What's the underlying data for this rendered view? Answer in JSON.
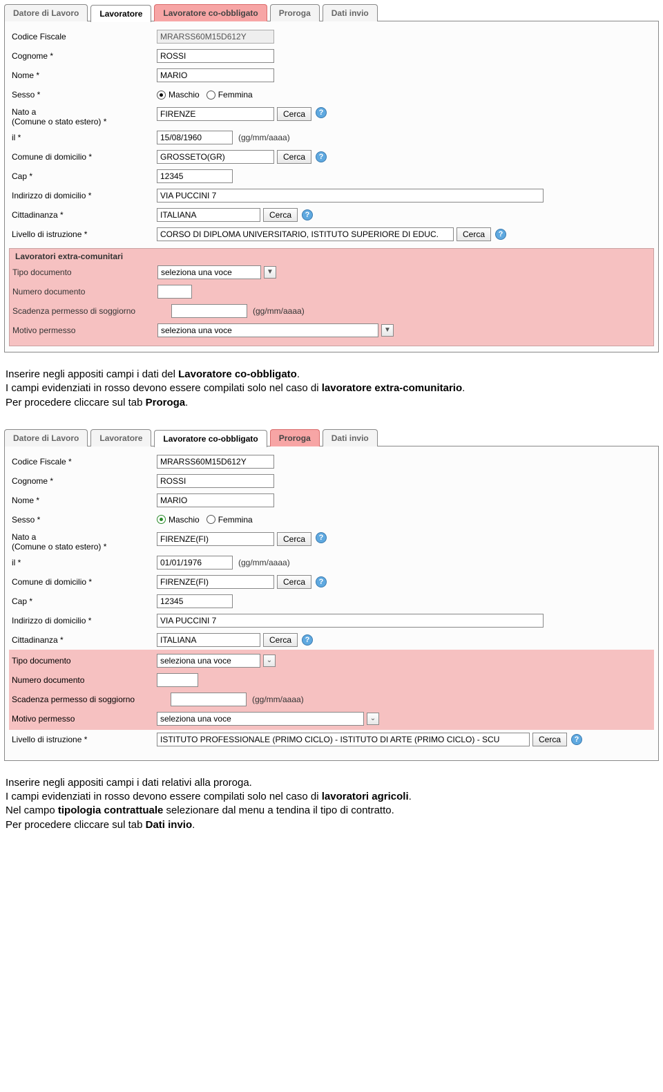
{
  "common": {
    "cerca": "Cerca",
    "date_hint": "(gg/mm/aaaa)",
    "maschio": "Maschio",
    "femmina": "Femmina",
    "dropdown_placeholder": "seleziona una voce"
  },
  "tabs": {
    "t1": "Datore di Lavoro",
    "t2": "Lavoratore",
    "t3": "Lavoratore co-obbligato",
    "t4": "Proroga",
    "t5": "Dati invio"
  },
  "form1": {
    "labels": {
      "codice_fiscale": "Codice Fiscale",
      "cognome": "Cognome *",
      "nome": "Nome *",
      "sesso": "Sesso *",
      "nato_a": "Nato a\n(Comune o stato estero) *",
      "il": "il *",
      "comune_dom": "Comune di domicilio *",
      "cap": "Cap *",
      "indirizzo": "Indirizzo di domicilio *",
      "cittadinanza": "Cittadinanza *",
      "livello_istr": "Livello di istruzione *",
      "extra_title": "Lavoratori extra-comunitari",
      "tipo_doc": "Tipo documento",
      "num_doc": "Numero documento",
      "scadenza": "Scadenza permesso di soggiorno",
      "motivo": "Motivo permesso"
    },
    "values": {
      "codice_fiscale": "MRARSS60M15D612Y",
      "cognome": "ROSSI",
      "nome": "MARIO",
      "nato_a": "FIRENZE",
      "il": "15/08/1960",
      "comune_dom": "GROSSETO(GR)",
      "cap": "12345",
      "indirizzo": "VIA PUCCINI 7",
      "cittadinanza": "ITALIANA",
      "livello_istr": "CORSO DI DIPLOMA UNIVERSITARIO, ISTITUTO SUPERIORE DI EDUC."
    }
  },
  "instr1": {
    "line1a": "Inserire negli appositi campi i dati del ",
    "line1b": "Lavoratore co-obbligato",
    "line1c": ".",
    "line2a": "I campi evidenziati in rosso devono essere compilati solo nel caso di ",
    "line2b": "lavoratore extra-comunitario",
    "line2c": ".",
    "line3a": "Per procedere cliccare sul tab ",
    "line3b": "Proroga",
    "line3c": "."
  },
  "form2": {
    "labels": {
      "codice_fiscale": "Codice Fiscale *",
      "cognome": "Cognome *",
      "nome": "Nome *",
      "sesso": "Sesso *",
      "nato_a": "Nato a\n(Comune o stato estero) *",
      "il": "il *",
      "comune_dom": "Comune di domicilio *",
      "cap": "Cap *",
      "indirizzo": "Indirizzo di domicilio *",
      "cittadinanza": "Cittadinanza *",
      "tipo_doc": "Tipo documento",
      "num_doc": "Numero documento",
      "scadenza": "Scadenza permesso di soggiorno",
      "motivo": "Motivo permesso",
      "livello_istr": "Livello di istruzione *"
    },
    "values": {
      "codice_fiscale": "MRARSS60M15D612Y",
      "cognome": "ROSSI",
      "nome": "MARIO",
      "nato_a": "FIRENZE(FI)",
      "il": "01/01/1976",
      "comune_dom": "FIRENZE(FI)",
      "cap": "12345",
      "indirizzo": "VIA PUCCINI 7",
      "cittadinanza": "ITALIANA",
      "livello_istr": "ISTITUTO PROFESSIONALE (PRIMO CICLO) - ISTITUTO DI ARTE (PRIMO CICLO) - SCU"
    }
  },
  "instr2": {
    "line1": "Inserire negli appositi campi i dati relativi alla proroga.",
    "line2a": "I campi evidenziati in rosso devono essere compilati solo nel caso di ",
    "line2b": "lavoratori agricoli",
    "line2c": ".",
    "line3a": "Nel campo ",
    "line3b": "tipologia contrattuale",
    "line3c": " selezionare dal menu a tendina il tipo di contratto.",
    "line4a": "Per procedere cliccare sul tab ",
    "line4b": "Dati invio",
    "line4c": "."
  }
}
